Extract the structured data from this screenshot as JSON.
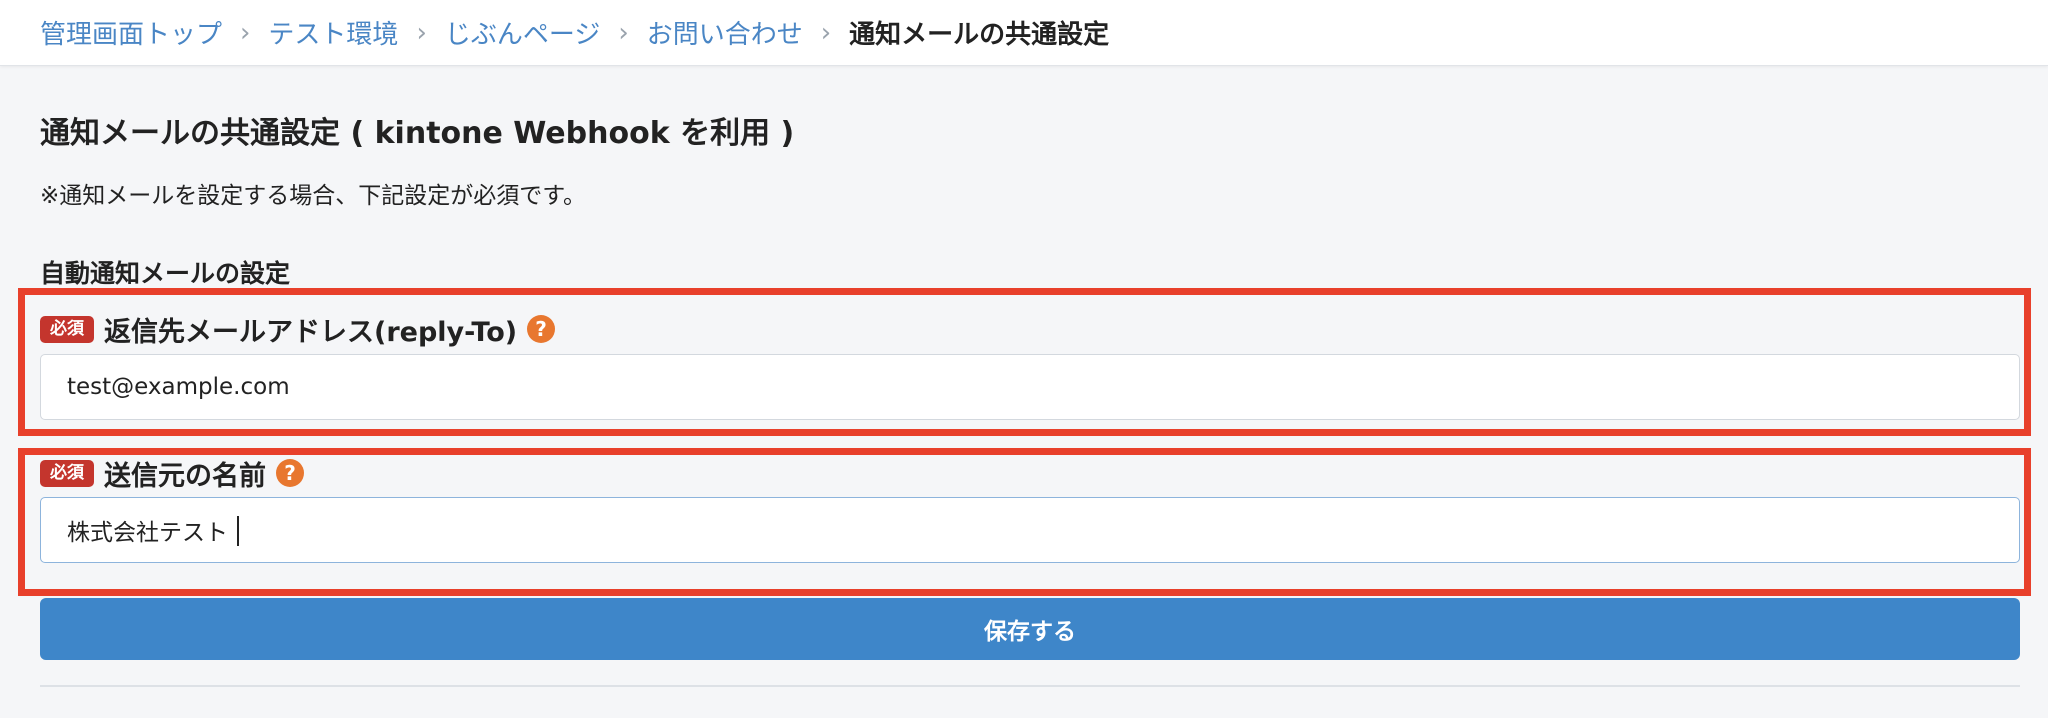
{
  "breadcrumb": {
    "items": [
      "管理画面トップ",
      "テスト環境",
      "じぶんページ",
      "お問い合わせ"
    ],
    "current": "通知メールの共通設定",
    "separator": "›"
  },
  "page": {
    "title": "通知メールの共通設定 ( kintone Webhook を利用 )",
    "notice": "※通知メールを設定する場合、下記設定が必須です。",
    "section_title": "自動通知メールの設定"
  },
  "fields": {
    "reply_to": {
      "required_label": "必須",
      "label": "返信先メールアドレス(reply-To)",
      "help": "?",
      "value": "test@example.com"
    },
    "sender_name": {
      "required_label": "必須",
      "label": "送信元の名前",
      "help": "?",
      "value": "株式会社テスト"
    }
  },
  "actions": {
    "save_label": "保存する"
  },
  "colors": {
    "link": "#4a86c5",
    "required_badge": "#c4352d",
    "help_icon": "#e8772f",
    "primary_button": "#3e86c9",
    "highlight": "#e8402b"
  }
}
